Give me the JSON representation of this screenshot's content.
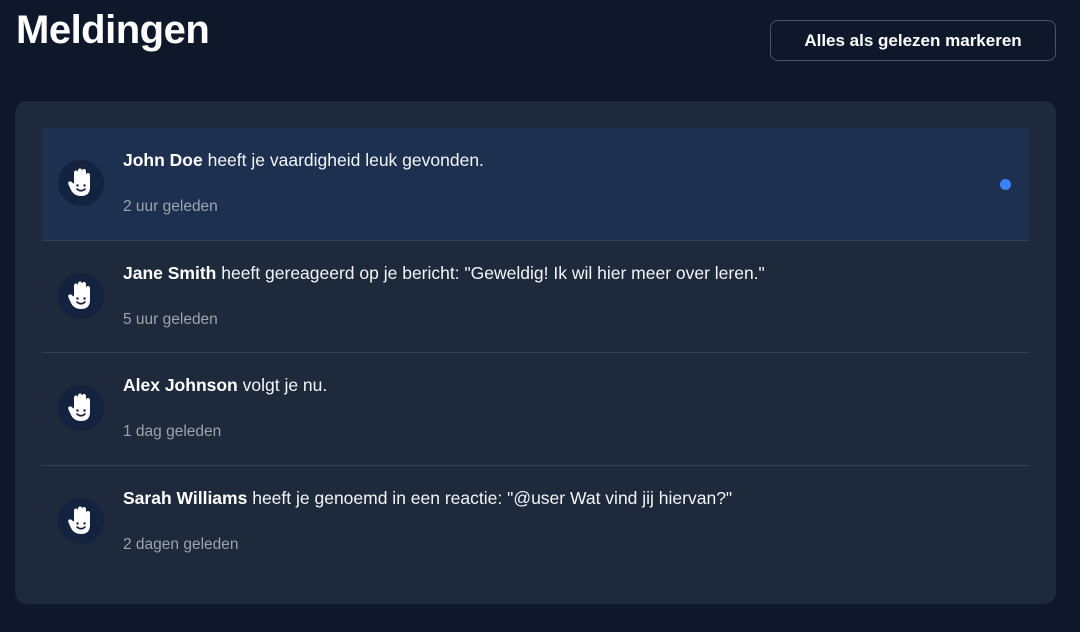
{
  "header": {
    "title": "Meldingen",
    "mark_all_label": "Alles als gelezen markeren"
  },
  "notifications": [
    {
      "user": "John Doe",
      "text": " heeft je vaardigheid leuk gevonden.",
      "time": "2 uur geleden",
      "unread": true,
      "avatar_icon": "hand-icon"
    },
    {
      "user": "Jane Smith",
      "text": " heeft gereageerd op je bericht: \"Geweldig! Ik wil hier meer over leren.\"",
      "time": "5 uur geleden",
      "unread": false,
      "avatar_icon": "hand-icon"
    },
    {
      "user": "Alex Johnson",
      "text": " volgt je nu.",
      "time": "1 dag geleden",
      "unread": false,
      "avatar_icon": "hand-icon"
    },
    {
      "user": "Sarah Williams",
      "text": " heeft je genoemd in een reactie: \"@user Wat vind jij hiervan?\"",
      "time": "2 dagen geleden",
      "unread": false,
      "avatar_icon": "hand-icon"
    }
  ],
  "colors": {
    "background": "#0f172a",
    "panel": "#1e293b",
    "unread_row": "#1e3050",
    "unread_dot": "#3b82f6",
    "muted_text": "#9ca3af"
  }
}
